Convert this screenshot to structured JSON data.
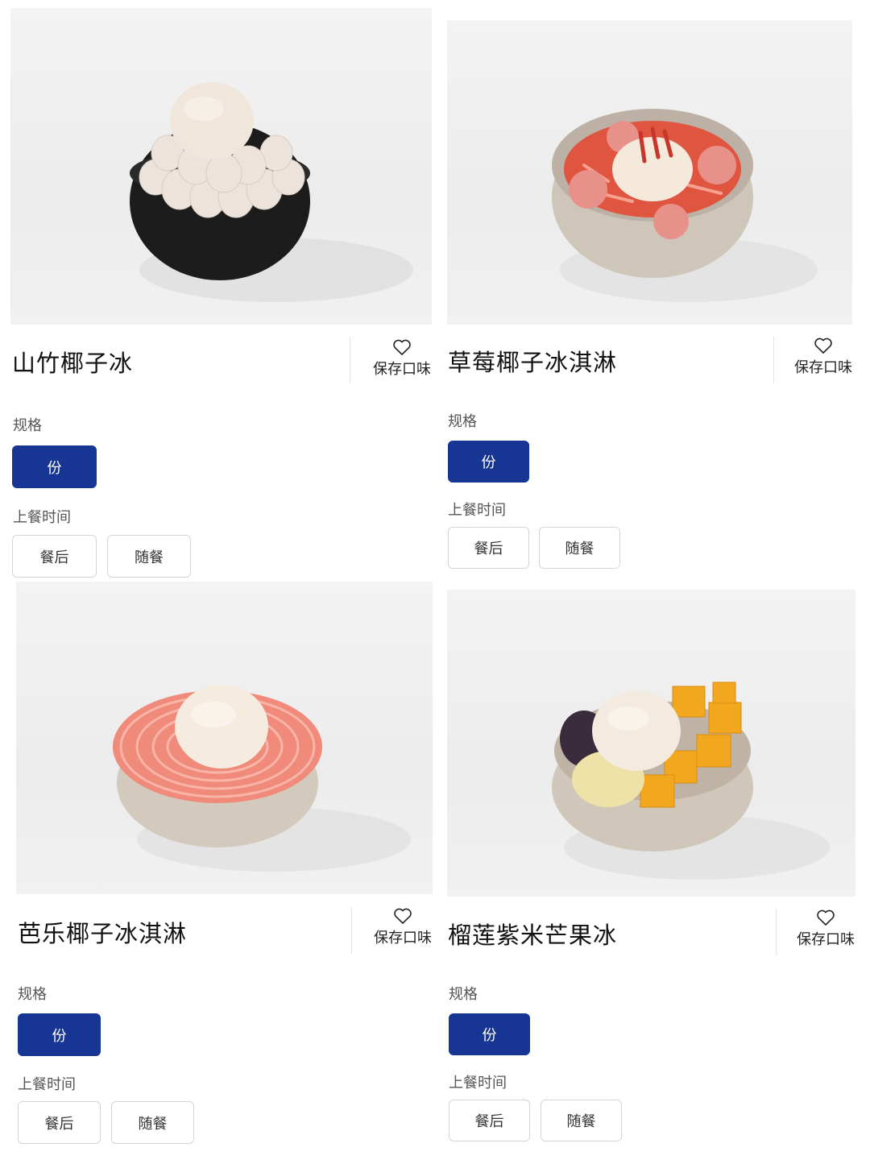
{
  "save_label": "保存口味",
  "spec_label": "规格",
  "time_label": "上餐时间",
  "accent_color": "#173593",
  "products": [
    {
      "name": "山竹椰子冰",
      "spec_options": [
        "份"
      ],
      "selected_spec": "份",
      "time_options": [
        "餐后",
        "随餐"
      ],
      "image": "mangosteen-coconut-ice-photo"
    },
    {
      "name": "草莓椰子冰淇淋",
      "spec_options": [
        "份"
      ],
      "selected_spec": "份",
      "time_options": [
        "餐后",
        "随餐"
      ],
      "image": "strawberry-coconut-ice-cream-photo"
    },
    {
      "name": "芭乐椰子冰淇淋",
      "spec_options": [
        "份"
      ],
      "selected_spec": "份",
      "time_options": [
        "餐后",
        "随餐"
      ],
      "image": "guava-coconut-ice-cream-photo"
    },
    {
      "name": "榴莲紫米芒果冰",
      "spec_options": [
        "份"
      ],
      "selected_spec": "份",
      "time_options": [
        "餐后",
        "随餐"
      ],
      "image": "durian-purple-rice-mango-ice-photo"
    }
  ]
}
